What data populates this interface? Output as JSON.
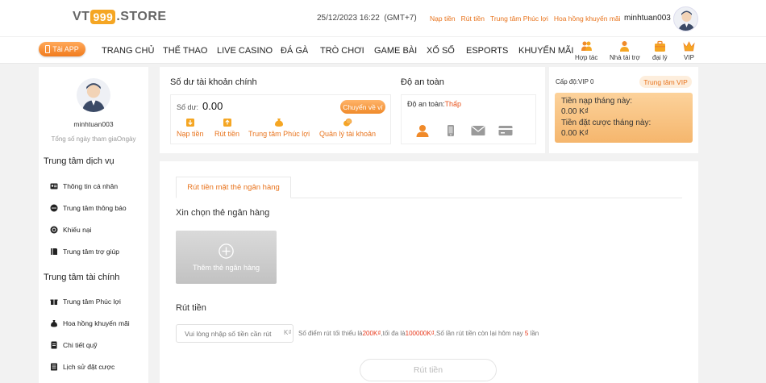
{
  "header": {
    "logo": {
      "left": "VT",
      "mid": "999",
      "right": ".STORE"
    },
    "datetime": "25/12/2023 16:22",
    "timezone": "(GMT+7)",
    "links": [
      "Nạp tiền",
      "Rút tiền",
      "Trung tâm Phúc lợi",
      "Hoa hồng khuyến mãi"
    ],
    "username": "minhtuan003"
  },
  "nav": {
    "app_button": "Tải APP",
    "items": [
      "TRANG CHỦ",
      "THỂ THAO",
      "LIVE CASINO",
      "ĐÁ GÀ",
      "TRÒ CHƠI",
      "GAME BÀI",
      "XỔ SỐ",
      "ESPORTS",
      "KHUYẾN MÃI"
    ],
    "icon_items": [
      "Hợp tác",
      "Nhà tài trợ",
      "đại lý",
      "VIP"
    ]
  },
  "sidebar": {
    "username": "minhtuan003",
    "days_label": "Tổng số ngày tham giaOngày",
    "service_title": "Trung tâm dịch vụ",
    "service_items": [
      "Thông tin cá nhân",
      "Trung tâm thông báo",
      "Khiếu nại",
      "Trung tâm trợ giúp"
    ],
    "finance_title": "Trung tâm tài chính",
    "finance_items": [
      "Trung tâm Phúc lợi",
      "Hoa hồng khuyến mãi",
      "Chi tiết quỹ",
      "Lịch sử đặt cược"
    ]
  },
  "balance": {
    "title": "Số dư tài khoản chính",
    "label": "Số dư:",
    "value": "0.00",
    "transfer_button": "Chuyển về ví",
    "actions": [
      "Nạp tiền",
      "Rút tiền",
      "Trung tâm Phúc lợi",
      "Quản lý tài khoản"
    ]
  },
  "security": {
    "title": "Độ an toàn",
    "label": "Độ an toàn:",
    "level": "Thấp"
  },
  "vip": {
    "level": "Cấp độ:VIP 0",
    "center_button": "Trung tâm VIP",
    "deposit_label": "Tiền nạp tháng này:",
    "deposit_value": "0.00 K₫",
    "bet_label": "Tiền đặt cược tháng này:",
    "bet_value": "0.00 K₫"
  },
  "withdraw": {
    "tab": "Rút tiền mặt thẻ ngân hàng",
    "choose_title": "Xin chọn thẻ ngân hàng",
    "add_bank": "Thêm thẻ ngân hàng",
    "section_title": "Rút tiền",
    "input_placeholder": "Vui lòng nhập số tiền cần rút",
    "currency": "K₫",
    "rule_min_prefix": "Số điểm rút tối thiểu là",
    "rule_min": "200K₫",
    "rule_max_prefix": ",tối đa là",
    "rule_max": "100000K₫",
    "rule_count_prefix": ",Số lần rút tiền còn lại hôm nay",
    "rule_count": "5",
    "rule_count_suffix": "lần",
    "submit": "Rút tiền"
  },
  "colors": {
    "accent": "#e8731c",
    "highlight": "#e8391c",
    "vip_panel": "#f5b66d"
  }
}
